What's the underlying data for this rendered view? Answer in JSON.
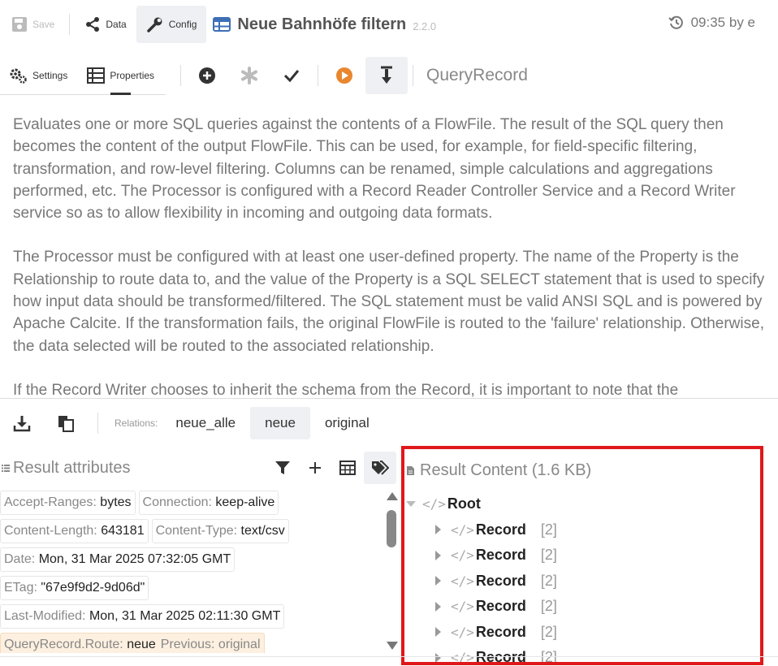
{
  "toolbar": {
    "save_label": "Save",
    "data_label": "Data",
    "config_label": "Config",
    "flow_name": "Neue Bahnhöfe filtern",
    "version": "2.2.0",
    "history_text": "09:35 by e"
  },
  "subbar": {
    "settings_label": "Settings",
    "properties_label": "Properties",
    "processor_type": "QueryRecord"
  },
  "description": {
    "p1": "Evaluates one or more SQL queries against the contents of a FlowFile. The result of the SQL query then becomes the content of the output FlowFile. This can be used, for example, for field-specific filtering, transformation, and row-level filtering. Columns can be renamed, simple calculations and aggregations performed, etc. The Processor is configured with a Record Reader Controller Service and a Record Writer service so as to allow flexibility in incoming and outgoing data formats.",
    "p2": "The Processor must be configured with at least one user-defined property. The name of the Property is the Relationship to route data to, and the value of the Property is a SQL SELECT statement that is used to specify how input data should be transformed/filtered. The SQL statement must be valid ANSI SQL and is powered by Apache Calcite. If the transformation fails, the original FlowFile is routed to the 'failure' relationship. Otherwise, the data selected will be routed to the associated relationship.",
    "p3": "If the Record Writer chooses to inherit the schema from the Record, it is important to note that the"
  },
  "relations": {
    "label": "Relations:",
    "items": [
      "neue_alle",
      "neue",
      "original"
    ],
    "selected": "neue"
  },
  "attributes": {
    "title": "Result attributes",
    "items": [
      {
        "key": "Accept-Ranges:",
        "value": "bytes"
      },
      {
        "key": "Connection:",
        "value": "keep-alive"
      },
      {
        "key": "Content-Length:",
        "value": "643181"
      },
      {
        "key": "Content-Type:",
        "value": "text/csv"
      },
      {
        "key": "Date:",
        "value": "Mon, 31 Mar 2025 07:32:05 GMT"
      },
      {
        "key": "ETag:",
        "value": "\"67e9f9d2-9d06d\""
      },
      {
        "key": "Last-Modified:",
        "value": "Mon, 31 Mar 2025 02:11:30 GMT"
      },
      {
        "key": "QueryRecord.Route:",
        "value": "neue",
        "previous": "Previous: original"
      }
    ]
  },
  "content": {
    "title": "Result Content (1.6 KB)",
    "root_label": "Root",
    "records": [
      {
        "label": "Record",
        "count": "[2]"
      },
      {
        "label": "Record",
        "count": "[2]"
      },
      {
        "label": "Record",
        "count": "[2]"
      },
      {
        "label": "Record",
        "count": "[2]"
      },
      {
        "label": "Record",
        "count": "[2]"
      },
      {
        "label": "Record",
        "count": "[2]"
      }
    ],
    "tag_glyph": "</>"
  },
  "colors": {
    "highlight_border": "#e0181b",
    "run_icon": "#e8872f",
    "table_icon": "#3d6fb6"
  }
}
